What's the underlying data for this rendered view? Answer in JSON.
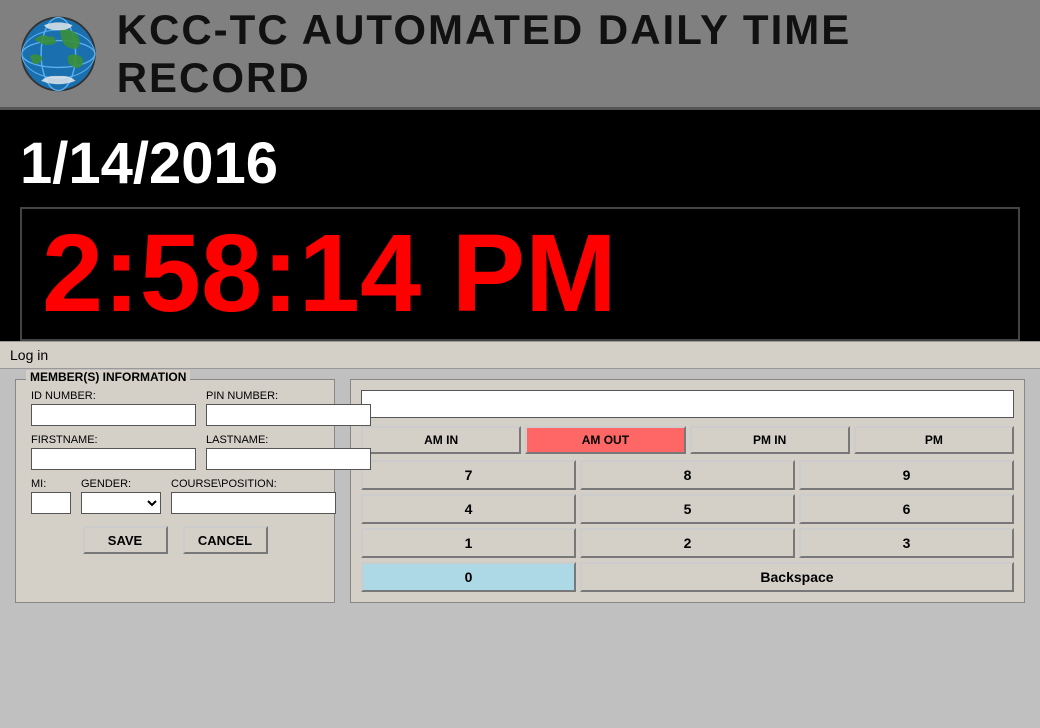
{
  "header": {
    "title": "KCC-TC AUTOMATED DAILY TIME RECORD"
  },
  "datetime": {
    "date": "1/14/2016",
    "time": "2:58:14 PM"
  },
  "login_bar": {
    "label": "Log in"
  },
  "member_info": {
    "legend": "MEMBER(S) INFORMATION",
    "id_number_label": "ID NUMBER:",
    "pin_number_label": "PIN NUMBER:",
    "firstname_label": "FIRSTNAME:",
    "lastname_label": "LASTNAME:",
    "mi_label": "MI:",
    "gender_label": "GENDER:",
    "course_position_label": "COURSE\\POSITION:",
    "save_button": "SAVE",
    "cancel_button": "CANCEL"
  },
  "numpad": {
    "display_value": "",
    "action_buttons": [
      {
        "id": "am-in",
        "label": "AM IN",
        "active": false
      },
      {
        "id": "am-out",
        "label": "AM OUT",
        "active": true
      },
      {
        "id": "pm-in",
        "label": "PM IN",
        "active": false
      },
      {
        "id": "pm",
        "label": "PM",
        "active": false
      }
    ],
    "number_buttons": [
      "7",
      "8",
      "9",
      "4",
      "5",
      "6",
      "1",
      "2",
      "3",
      "0",
      "Backspace"
    ]
  }
}
